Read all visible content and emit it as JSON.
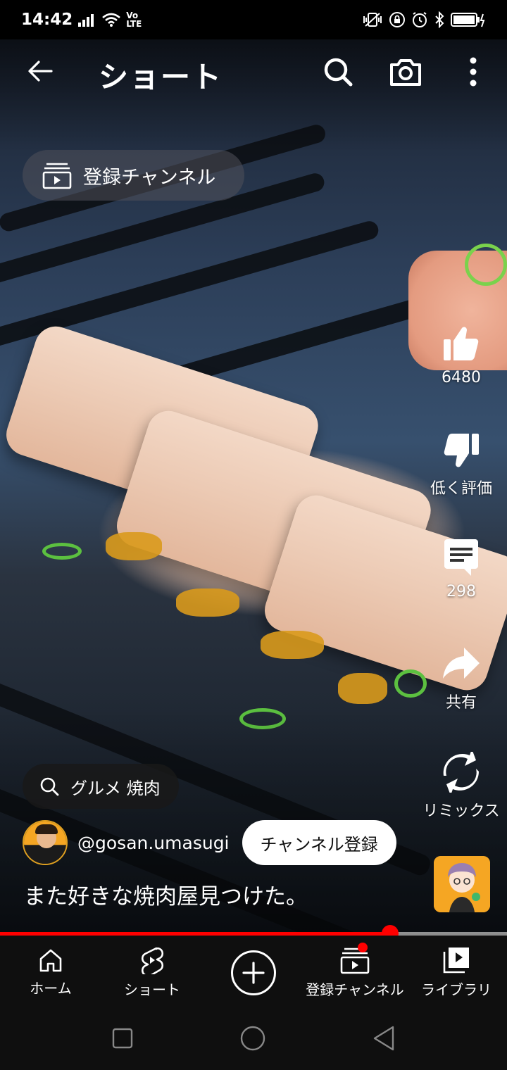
{
  "status_bar": {
    "time": "14:42",
    "volte": "Vo LTE",
    "icons": [
      "signal-icon",
      "wifi-icon",
      "vibrate-icon",
      "rotation-lock-icon",
      "alarm-icon",
      "bluetooth-icon",
      "battery-icon"
    ]
  },
  "header": {
    "title": "ショート",
    "back_icon": "arrow-left-icon",
    "search_icon": "search-icon",
    "camera_icon": "camera-icon",
    "more_icon": "more-vert-icon"
  },
  "subscriptions_chip": {
    "label": "登録チャンネル"
  },
  "actions": {
    "like": {
      "count": "6480"
    },
    "dislike": {
      "label": "低く評価"
    },
    "comments": {
      "count": "298"
    },
    "share": {
      "label": "共有"
    },
    "remix": {
      "label": "リミックス"
    }
  },
  "search_pill": {
    "label": "グルメ 焼肉"
  },
  "channel": {
    "handle": "@gosan.umasugi",
    "subscribe_label": "チャンネル登録"
  },
  "caption": "また好きな焼肉屋見つけた。",
  "progress": {
    "fraction": 0.77
  },
  "bottom_nav": {
    "items": [
      {
        "label": "ホーム"
      },
      {
        "label": "ショート"
      },
      {
        "label": ""
      },
      {
        "label": "登録チャンネル"
      },
      {
        "label": "ライブラリ"
      }
    ]
  },
  "colors": {
    "accent": "#ff0000",
    "nav_bg": "#0f0f0f",
    "subscribe_bg": "#ffffff"
  }
}
